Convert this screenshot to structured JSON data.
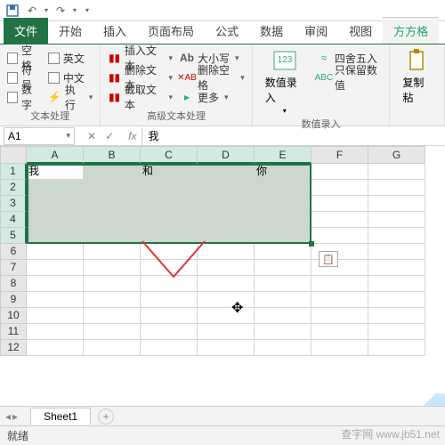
{
  "qat": {
    "save": "保存",
    "undo": "撤销",
    "redo": "重做"
  },
  "tabs": {
    "file": "文件",
    "items": [
      "开始",
      "插入",
      "页面布局",
      "公式",
      "数据",
      "审阅",
      "视图",
      "方方格"
    ]
  },
  "ribbon": {
    "group1": {
      "label": "文本处理",
      "items": [
        {
          "label": "空格"
        },
        {
          "label": "英文"
        },
        {
          "label": "符号"
        },
        {
          "label": "中文"
        },
        {
          "label": "数字"
        },
        {
          "label": "执行"
        }
      ]
    },
    "group2": {
      "label": "高级文本处理",
      "col1": [
        {
          "label": "插入文本"
        },
        {
          "label": "删除文本"
        },
        {
          "label": "截取文本"
        }
      ],
      "col2": [
        {
          "label": "大小写"
        },
        {
          "label": "删除空格"
        },
        {
          "label": "更多"
        }
      ]
    },
    "group3": {
      "label": "数值录入",
      "big": "数值录入",
      "items": [
        {
          "label": "四舍五入"
        },
        {
          "label": "只保留数值"
        }
      ]
    },
    "group4": {
      "big": "复制粘"
    }
  },
  "namebox": {
    "ref": "A1",
    "formula": "我"
  },
  "grid": {
    "cols": [
      "A",
      "B",
      "C",
      "D",
      "E",
      "F",
      "G"
    ],
    "rows": [
      "1",
      "2",
      "3",
      "4",
      "5",
      "6",
      "7",
      "8",
      "9",
      "10",
      "11",
      "12"
    ],
    "cells": {
      "A1": "我",
      "C1": "和",
      "E1": "你"
    },
    "selection": {
      "r1": 1,
      "c1": 1,
      "r2": 5,
      "c2": 5,
      "active": "A1"
    }
  },
  "sheetTabs": {
    "active": "Sheet1",
    "add": "+"
  },
  "status": {
    "ready": "就绪",
    "watermark": "查字网 www.jb51.net"
  }
}
